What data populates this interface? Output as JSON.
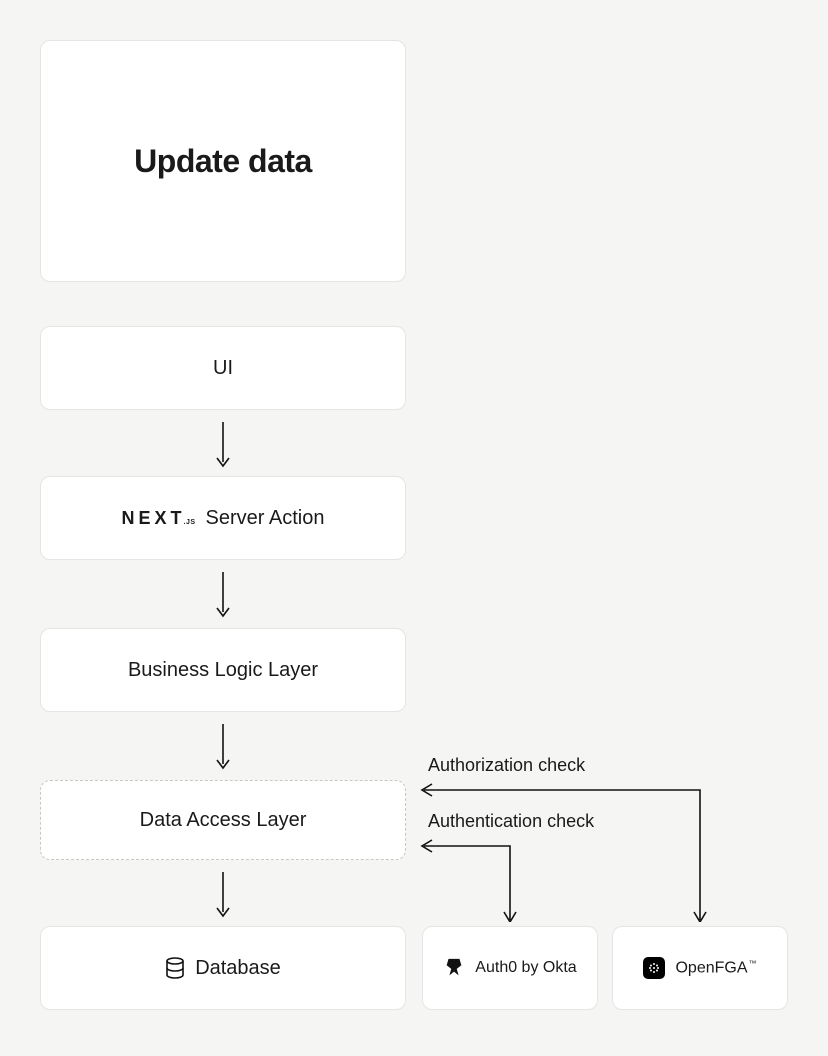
{
  "title": "Update data",
  "nodes": {
    "ui": "UI",
    "server_action": "Server Action",
    "business_logic": "Business Logic Layer",
    "data_access": "Data Access Layer",
    "database": "Database",
    "auth0": "Auth0 by Okta",
    "openfga": "OpenFGA",
    "openfga_tm": "™"
  },
  "labels": {
    "authorization_check": "Authorization check",
    "authentication_check": "Authentication check"
  },
  "logos": {
    "nextjs_main": "NEXT",
    "nextjs_sub": ".JS"
  }
}
